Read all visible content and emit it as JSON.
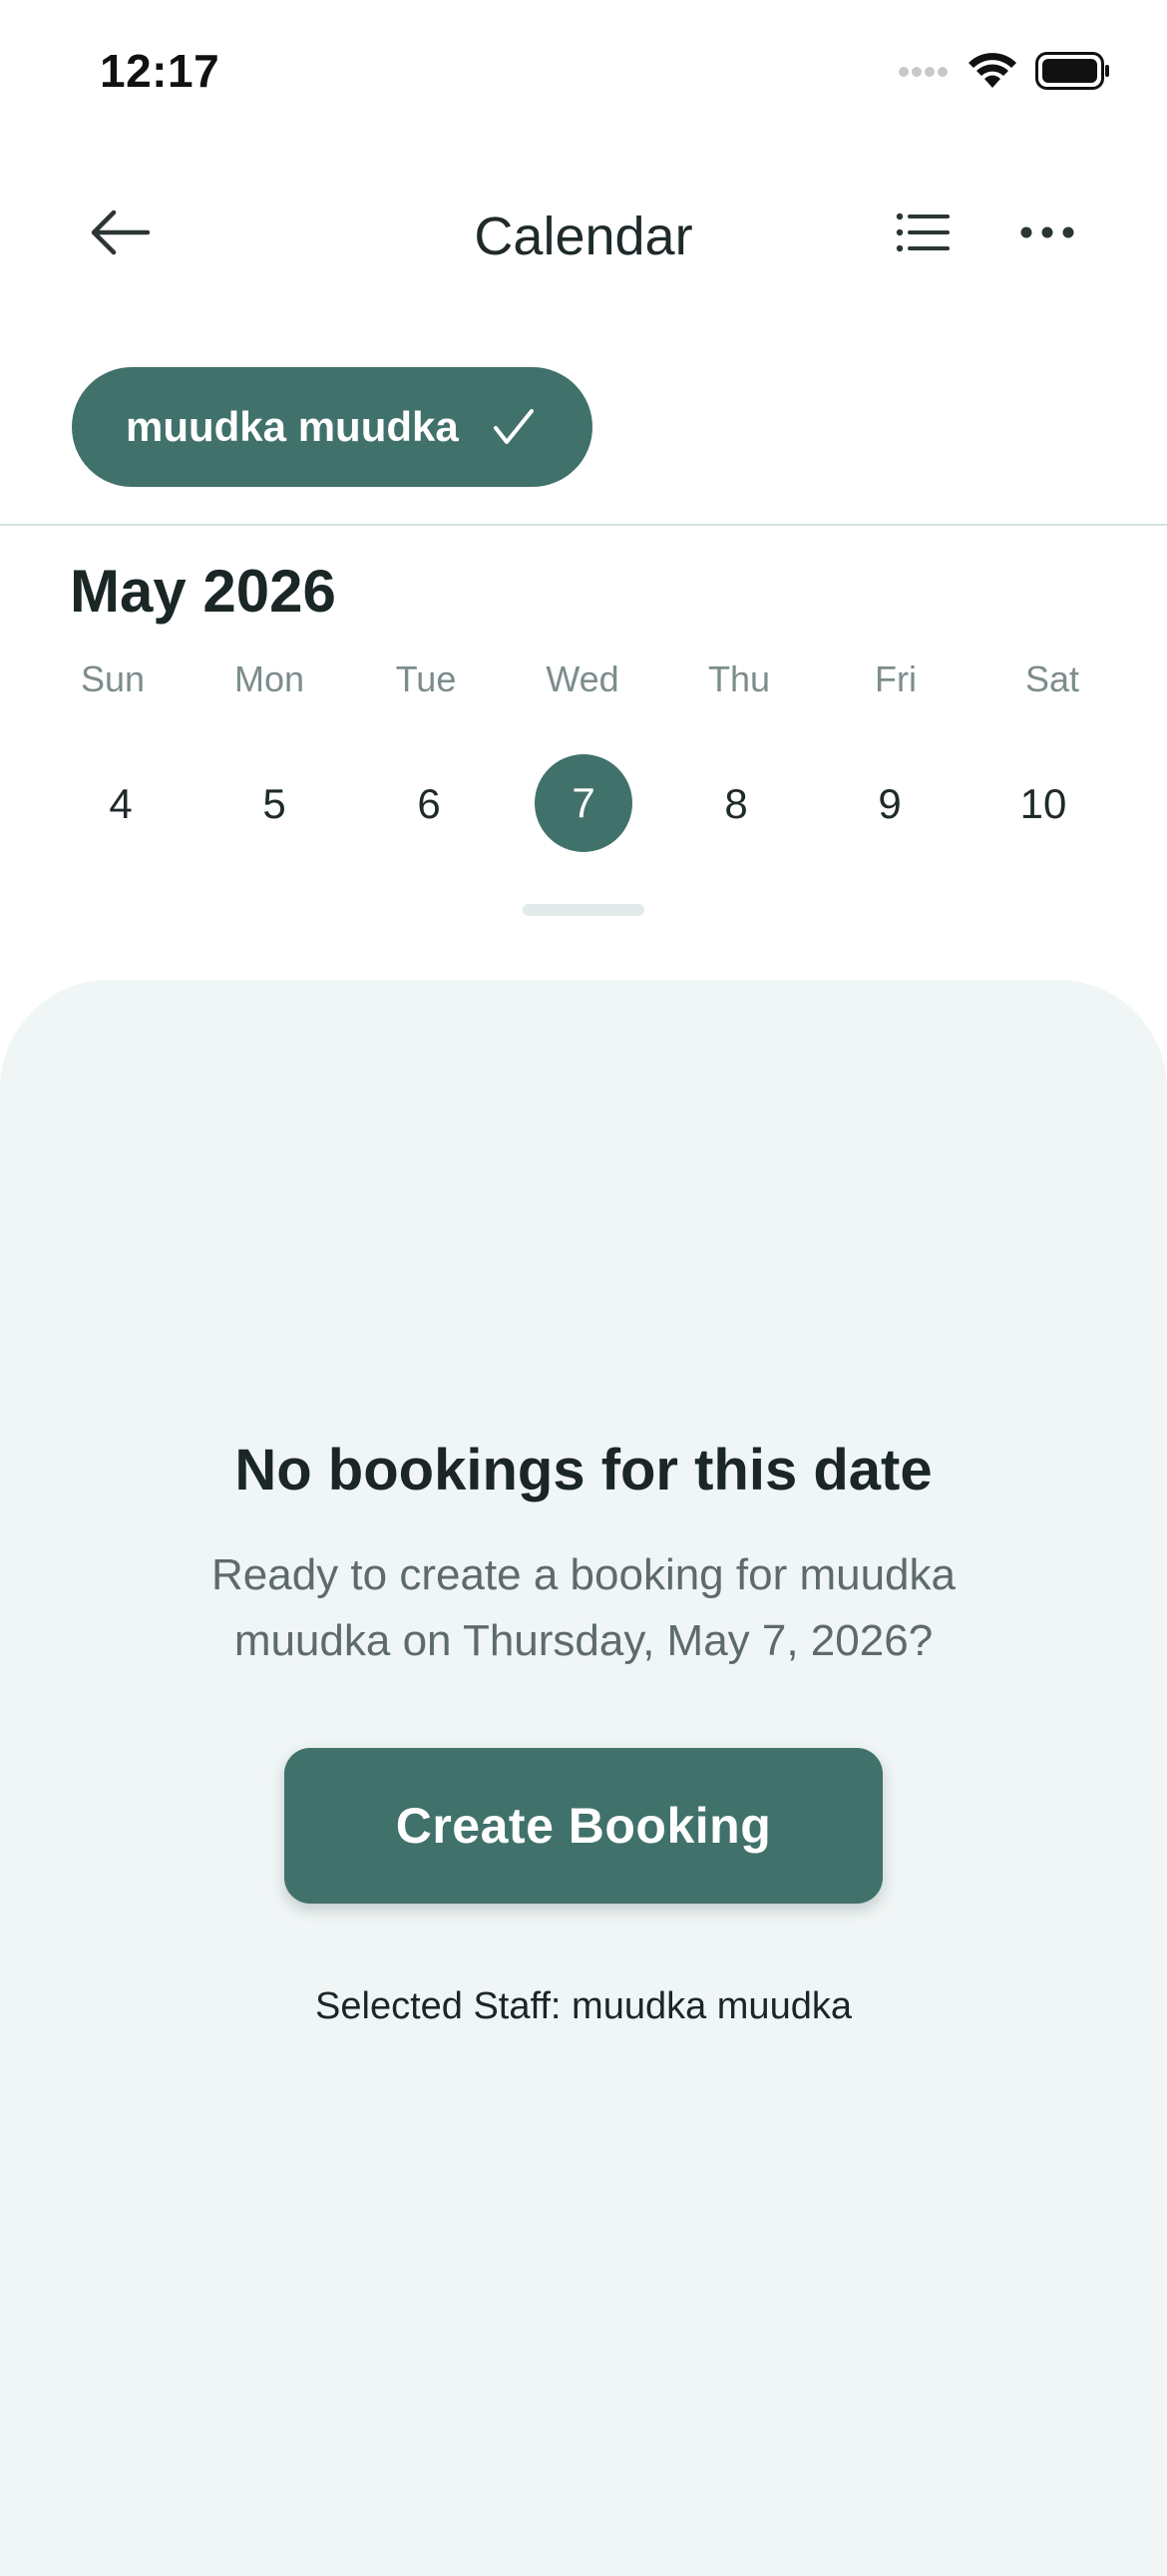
{
  "status_bar": {
    "time": "12:17",
    "icons": [
      "signal-icon",
      "wifi-icon",
      "battery-icon"
    ]
  },
  "nav": {
    "back_icon": "arrow-left-icon",
    "title": "Calendar",
    "list_icon": "list-icon",
    "more_icon": "more-horizontal-icon"
  },
  "staff_chip": {
    "label": "muudka muudka",
    "icon": "check-icon",
    "selected": true
  },
  "calendar": {
    "month_label": "May 2026",
    "weekdays": [
      "Sun",
      "Mon",
      "Tue",
      "Wed",
      "Thu",
      "Fri",
      "Sat"
    ],
    "days": [
      "4",
      "5",
      "6",
      "7",
      "8",
      "9",
      "10"
    ],
    "selected_day": "7"
  },
  "empty_state": {
    "title": "No bookings for this date",
    "description": "Ready to create a booking for muudka muudka on Thursday, May 7, 2026?",
    "button_label": "Create Booking",
    "selected_staff": "Selected Staff: muudka muudka"
  },
  "colors": {
    "accent": "#41716b",
    "sheet_background": "#f0f5f5",
    "muted_text": "#7d8c8c"
  }
}
